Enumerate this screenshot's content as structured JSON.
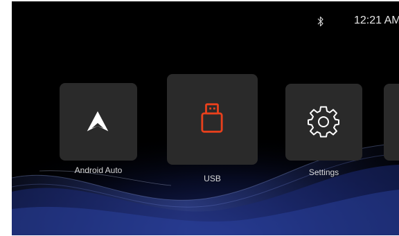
{
  "status_bar": {
    "time": "12:21 AM",
    "bluetooth_icon": "bluetooth-icon"
  },
  "apps": [
    {
      "label": "Android Auto",
      "icon": "android-auto-icon",
      "selected": false
    },
    {
      "label": "USB",
      "icon": "usb-drive-icon",
      "selected": true,
      "icon_color": "#e8401c"
    },
    {
      "label": "Settings",
      "icon": "gear-icon",
      "selected": false
    }
  ],
  "colors": {
    "background": "#000000",
    "tile": "#2a2a2a",
    "accent": "#e8401c",
    "wave": "#2b3f8f"
  }
}
